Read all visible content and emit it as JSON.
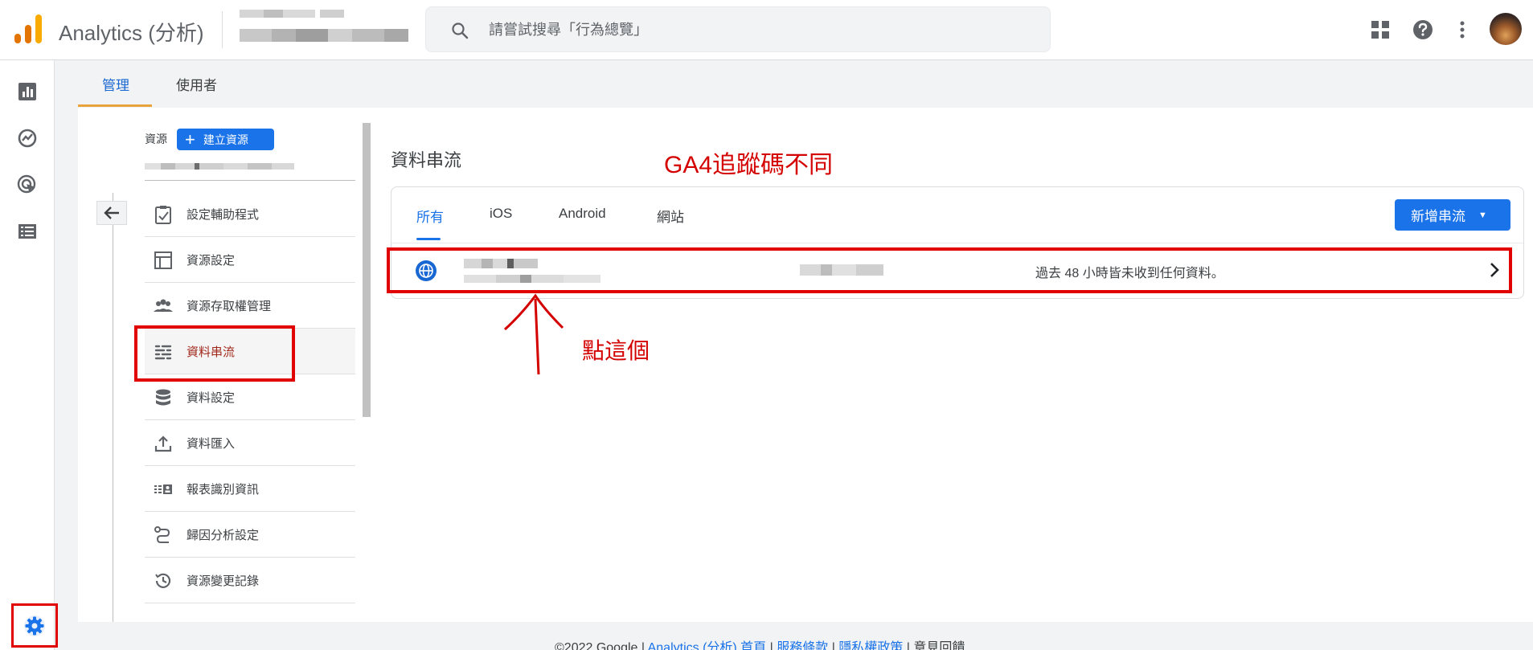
{
  "header": {
    "app_title": "Analytics (分析)",
    "search_placeholder": "請嘗試搜尋「行為總覽」"
  },
  "admin_tabs": [
    {
      "label": "管理",
      "active": true
    },
    {
      "label": "使用者",
      "active": false
    }
  ],
  "property": {
    "label": "資源",
    "create_button": "建立資源"
  },
  "menu": [
    {
      "label": "設定輔助程式",
      "icon": "checklist-icon"
    },
    {
      "label": "資源設定",
      "icon": "layout-icon"
    },
    {
      "label": "資源存取權管理",
      "icon": "people-icon"
    },
    {
      "label": "資料串流",
      "icon": "streams-icon",
      "selected": true
    },
    {
      "label": "資料設定",
      "icon": "database-icon"
    },
    {
      "label": "資料匯入",
      "icon": "upload-icon"
    },
    {
      "label": "報表識別資訊",
      "icon": "id-card-icon"
    },
    {
      "label": "歸因分析設定",
      "icon": "attribution-icon"
    },
    {
      "label": "資源變更記錄",
      "icon": "history-icon"
    }
  ],
  "streams": {
    "title": "資料串流",
    "tabs": [
      {
        "label": "所有",
        "active": true
      },
      {
        "label": "iOS",
        "active": false
      },
      {
        "label": "Android",
        "active": false
      },
      {
        "label": "網站",
        "active": false
      }
    ],
    "add_button": "新增串流",
    "row": {
      "icon": "globe-icon",
      "status": "過去 48 小時皆未收到任何資料。"
    }
  },
  "annotations": {
    "ga4_note": "GA4追蹤碼不同",
    "click_note": "點這個"
  },
  "footer": {
    "copyright": "©2022 Google |",
    "links": [
      "Analytics (分析) 首頁",
      "服務條款",
      "隱私權政策"
    ],
    "separator": "|",
    "feedback": "意見回饋"
  },
  "colors": {
    "accent": "#1a73e8",
    "annotation": "#e00000",
    "selected_text": "#a1291c"
  }
}
